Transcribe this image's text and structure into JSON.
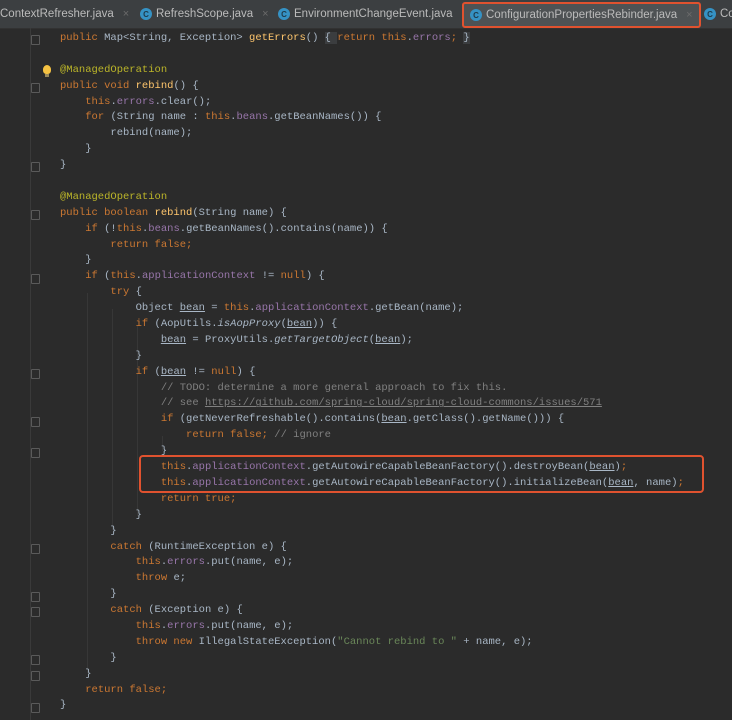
{
  "tabs": [
    {
      "label": "ContextRefresher.java",
      "active": false
    },
    {
      "label": "RefreshScope.java",
      "active": false
    },
    {
      "label": "EnvironmentChangeEvent.java",
      "active": false
    },
    {
      "label": "ConfigurationPropertiesRebinder.java",
      "active": true
    },
    {
      "label": "Co",
      "active": false
    }
  ],
  "tab_icon_letter": "C",
  "close_glyph": "×",
  "colors": {
    "background": "#2b2b2b",
    "keyword": "#cc7832",
    "method": "#ffc66d",
    "field": "#9876aa",
    "highlight_border": "#e0522f"
  },
  "code_lines": [
    [
      [
        "public ",
        "k"
      ],
      [
        "Map<String, Exception> ",
        ""
      ],
      [
        "getErrors",
        "m"
      ],
      [
        "() ",
        ""
      ],
      [
        "{ ",
        "fb"
      ],
      [
        "return ",
        "k"
      ],
      [
        "this",
        "k"
      ],
      [
        ".",
        ""
      ],
      [
        "errors",
        "f"
      ],
      [
        "; ",
        "k"
      ],
      [
        "}",
        "fb"
      ]
    ],
    [],
    [
      [
        "@ManagedOperation",
        "a"
      ]
    ],
    [
      [
        "public void ",
        "k"
      ],
      [
        "rebind",
        "m"
      ],
      [
        "() {",
        ""
      ]
    ],
    [
      [
        "    ",
        ""
      ],
      [
        "this",
        "k"
      ],
      [
        ".",
        ""
      ],
      [
        "errors",
        "f"
      ],
      [
        ".clear();",
        ""
      ]
    ],
    [
      [
        "    ",
        ""
      ],
      [
        "for ",
        "k"
      ],
      [
        "(String name : ",
        ""
      ],
      [
        "this",
        "k"
      ],
      [
        ".",
        ""
      ],
      [
        "beans",
        "f"
      ],
      [
        ".getBeanNames()) {",
        ""
      ]
    ],
    [
      [
        "        rebind(name);",
        ""
      ]
    ],
    [
      [
        "    }",
        ""
      ]
    ],
    [
      [
        "}",
        ""
      ]
    ],
    [],
    [
      [
        "@ManagedOperation",
        "a"
      ]
    ],
    [
      [
        "public boolean ",
        "k"
      ],
      [
        "rebind",
        "m"
      ],
      [
        "(String name) {",
        ""
      ]
    ],
    [
      [
        "    ",
        ""
      ],
      [
        "if ",
        "k"
      ],
      [
        "(!",
        ""
      ],
      [
        "this",
        "k"
      ],
      [
        ".",
        ""
      ],
      [
        "beans",
        "f"
      ],
      [
        ".getBeanNames().contains(name)) {",
        ""
      ]
    ],
    [
      [
        "        ",
        ""
      ],
      [
        "return false",
        "k"
      ],
      [
        ";",
        "k"
      ]
    ],
    [
      [
        "    }",
        ""
      ]
    ],
    [
      [
        "    ",
        ""
      ],
      [
        "if ",
        "k"
      ],
      [
        "(",
        ""
      ],
      [
        "this",
        "k"
      ],
      [
        ".",
        ""
      ],
      [
        "applicationContext",
        "f"
      ],
      [
        " != ",
        ""
      ],
      [
        "null",
        "k"
      ],
      [
        ") {",
        ""
      ]
    ],
    [
      [
        "        ",
        ""
      ],
      [
        "try ",
        "k"
      ],
      [
        "{",
        ""
      ]
    ],
    [
      [
        "            Object ",
        ""
      ],
      [
        "bean",
        "u"
      ],
      [
        " = ",
        ""
      ],
      [
        "this",
        "k"
      ],
      [
        ".",
        ""
      ],
      [
        "applicationContext",
        "f"
      ],
      [
        ".getBean(name);",
        ""
      ]
    ],
    [
      [
        "            ",
        ""
      ],
      [
        "if ",
        "k"
      ],
      [
        "(AopUtils.",
        ""
      ],
      [
        "isAopProxy",
        "i"
      ],
      [
        "(",
        ""
      ],
      [
        "bean",
        "u"
      ],
      [
        ")) {",
        ""
      ]
    ],
    [
      [
        "                ",
        ""
      ],
      [
        "bean",
        "u"
      ],
      [
        " = ProxyUtils.",
        ""
      ],
      [
        "getTargetObject",
        "i"
      ],
      [
        "(",
        ""
      ],
      [
        "bean",
        "u"
      ],
      [
        ");",
        ""
      ]
    ],
    [
      [
        "            }",
        ""
      ]
    ],
    [
      [
        "            ",
        ""
      ],
      [
        "if ",
        "k"
      ],
      [
        "(",
        ""
      ],
      [
        "bean",
        "u"
      ],
      [
        " != ",
        ""
      ],
      [
        "null",
        "k"
      ],
      [
        ") {",
        ""
      ]
    ],
    [
      [
        "                ",
        ""
      ],
      [
        "// TODO: determine a more general approach to fix this.",
        "c"
      ]
    ],
    [
      [
        "                ",
        ""
      ],
      [
        "// see ",
        "c"
      ],
      [
        "https://github.com/spring-cloud/spring-cloud-commons/issues/571",
        "l"
      ]
    ],
    [
      [
        "                ",
        ""
      ],
      [
        "if ",
        "k"
      ],
      [
        "(getNeverRefreshable().contains(",
        ""
      ],
      [
        "bean",
        "u"
      ],
      [
        ".getClass().getName())) {",
        ""
      ]
    ],
    [
      [
        "                    ",
        ""
      ],
      [
        "return false",
        "k"
      ],
      [
        "; ",
        "k"
      ],
      [
        "// ignore",
        "c"
      ]
    ],
    [
      [
        "                }",
        ""
      ]
    ],
    [
      [
        "                ",
        ""
      ],
      [
        "this",
        "k"
      ],
      [
        ".",
        ""
      ],
      [
        "applicationContext",
        "f"
      ],
      [
        ".getAutowireCapableBeanFactory().destroyBean(",
        ""
      ],
      [
        "bean",
        "u"
      ],
      [
        ")",
        ""
      ],
      [
        ";",
        "k"
      ]
    ],
    [
      [
        "                ",
        ""
      ],
      [
        "this",
        "k"
      ],
      [
        ".",
        ""
      ],
      [
        "applicationContext",
        "f"
      ],
      [
        ".getAutowireCapableBeanFactory().initializeBean(",
        ""
      ],
      [
        "bean",
        "u"
      ],
      [
        ", name)",
        ""
      ],
      [
        ";",
        "k"
      ]
    ],
    [
      [
        "                ",
        ""
      ],
      [
        "return true",
        "k"
      ],
      [
        ";",
        "k"
      ]
    ],
    [
      [
        "            }",
        ""
      ]
    ],
    [
      [
        "        }",
        ""
      ]
    ],
    [
      [
        "        ",
        ""
      ],
      [
        "catch ",
        "k"
      ],
      [
        "(RuntimeException e) {",
        ""
      ]
    ],
    [
      [
        "            ",
        ""
      ],
      [
        "this",
        "k"
      ],
      [
        ".",
        ""
      ],
      [
        "errors",
        "f"
      ],
      [
        ".put(name, e);",
        ""
      ]
    ],
    [
      [
        "            ",
        ""
      ],
      [
        "throw ",
        "k"
      ],
      [
        "e;",
        ""
      ]
    ],
    [
      [
        "        }",
        ""
      ]
    ],
    [
      [
        "        ",
        ""
      ],
      [
        "catch ",
        "k"
      ],
      [
        "(Exception e) {",
        ""
      ]
    ],
    [
      [
        "            ",
        ""
      ],
      [
        "this",
        "k"
      ],
      [
        ".",
        ""
      ],
      [
        "errors",
        "f"
      ],
      [
        ".put(name, e);",
        ""
      ]
    ],
    [
      [
        "            ",
        ""
      ],
      [
        "throw new ",
        "k"
      ],
      [
        "IllegalStateException(",
        ""
      ],
      [
        "\"Cannot rebind to \"",
        "s"
      ],
      [
        " + name, e);",
        ""
      ]
    ],
    [
      [
        "        }",
        ""
      ]
    ],
    [
      [
        "    }",
        ""
      ]
    ],
    [
      [
        "    ",
        ""
      ],
      [
        "return false",
        "k"
      ],
      [
        ";",
        "k"
      ]
    ],
    [
      [
        "}",
        ""
      ]
    ]
  ]
}
